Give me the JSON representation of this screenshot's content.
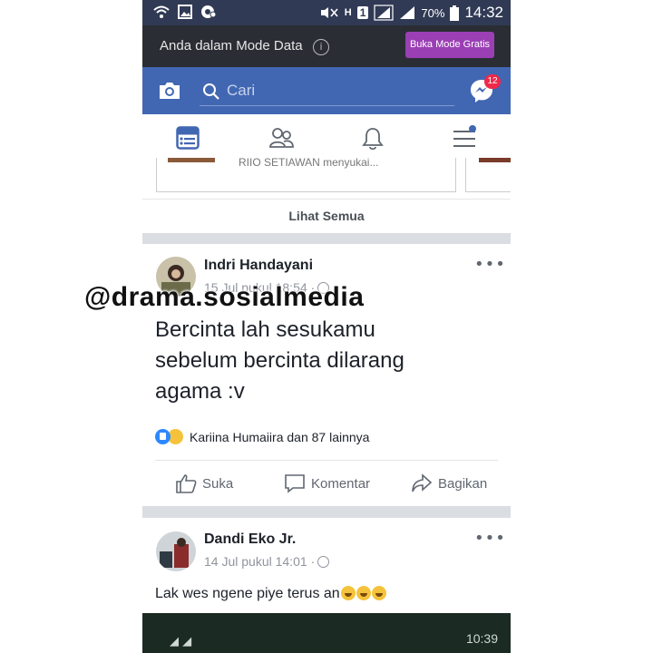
{
  "status_bar": {
    "battery": "70%",
    "time": "14:32",
    "sim_label": "1",
    "h_label": "H"
  },
  "mode_banner": {
    "text": "Anda dalam Mode Data",
    "info_glyph": "i",
    "button": "Buka Mode Gratis"
  },
  "search": {
    "placeholder": "Cari",
    "messenger_badge": "12"
  },
  "tabs": [
    "news-feed",
    "friends",
    "notifications",
    "menu"
  ],
  "story_strip": {
    "card_text": "RIIO SETIAWAN menyukai..."
  },
  "see_all": "Lihat Semua",
  "posts": [
    {
      "author": "Indri Handayani",
      "time": "15 Jul pukul 18:54 ·",
      "text_line1": "Bercinta lah sesukamu",
      "text_line2": "sebelum bercinta dilarang",
      "text_line3": "agama :v",
      "reactions": "Kariina Humaiira dan 87 lainnya"
    },
    {
      "author": "Dandi Eko Jr.",
      "time": "14 Jul pukul 14:01 ·",
      "text": "Lak wes ngene piye terus an"
    }
  ],
  "actions": {
    "like": "Suka",
    "comment": "Komentar",
    "share": "Bagikan"
  },
  "more_glyph": "•••",
  "watermark": "@drama.sosialmedia",
  "embedded_media": {
    "time": "10:39"
  },
  "colors": {
    "status_bar": "#303a54",
    "fb_blue": "#4267b2",
    "mode_button": "#9b3fb5",
    "badge_red": "#f02849"
  }
}
